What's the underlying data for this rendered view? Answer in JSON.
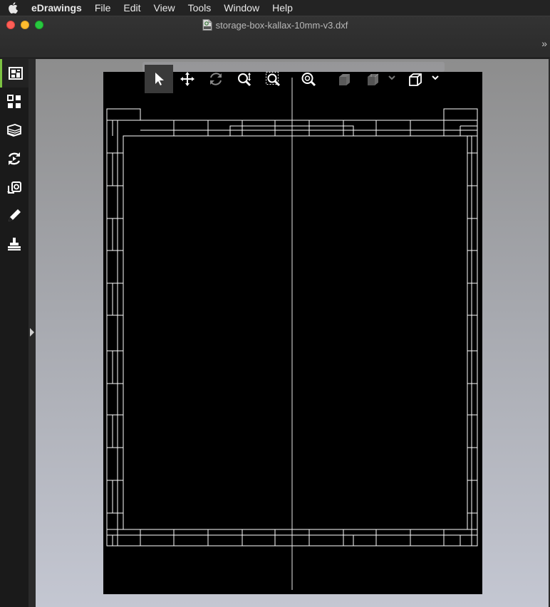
{
  "menubar": {
    "app_name": "eDrawings",
    "items": [
      "File",
      "Edit",
      "View",
      "Tools",
      "Window",
      "Help"
    ]
  },
  "window": {
    "title": "storage-box-kallax-10mm-v3.dxf",
    "expand_label": "»"
  },
  "sidebar": {
    "items": [
      {
        "name": "sheets-panel-icon",
        "active": true
      },
      {
        "name": "components-panel-icon",
        "active": false
      },
      {
        "name": "layers-panel-icon",
        "active": false
      },
      {
        "name": "animation-panel-icon",
        "active": false
      },
      {
        "name": "stamp-panel-icon",
        "active": false
      },
      {
        "name": "markup-pen-icon",
        "active": false
      },
      {
        "name": "measure-stamp-icon",
        "active": false
      }
    ]
  },
  "toolbar": {
    "tools": [
      "select-icon",
      "pan-icon",
      "rotate-icon",
      "zoom-icon",
      "zoom-area-icon",
      "zoom-fit-icon",
      "shaded-view-icon",
      "display-style-icon",
      "standard-views-icon"
    ]
  },
  "colors": {
    "accent": "#7cc242",
    "sheet": "#000000",
    "line": "#ffffff"
  }
}
